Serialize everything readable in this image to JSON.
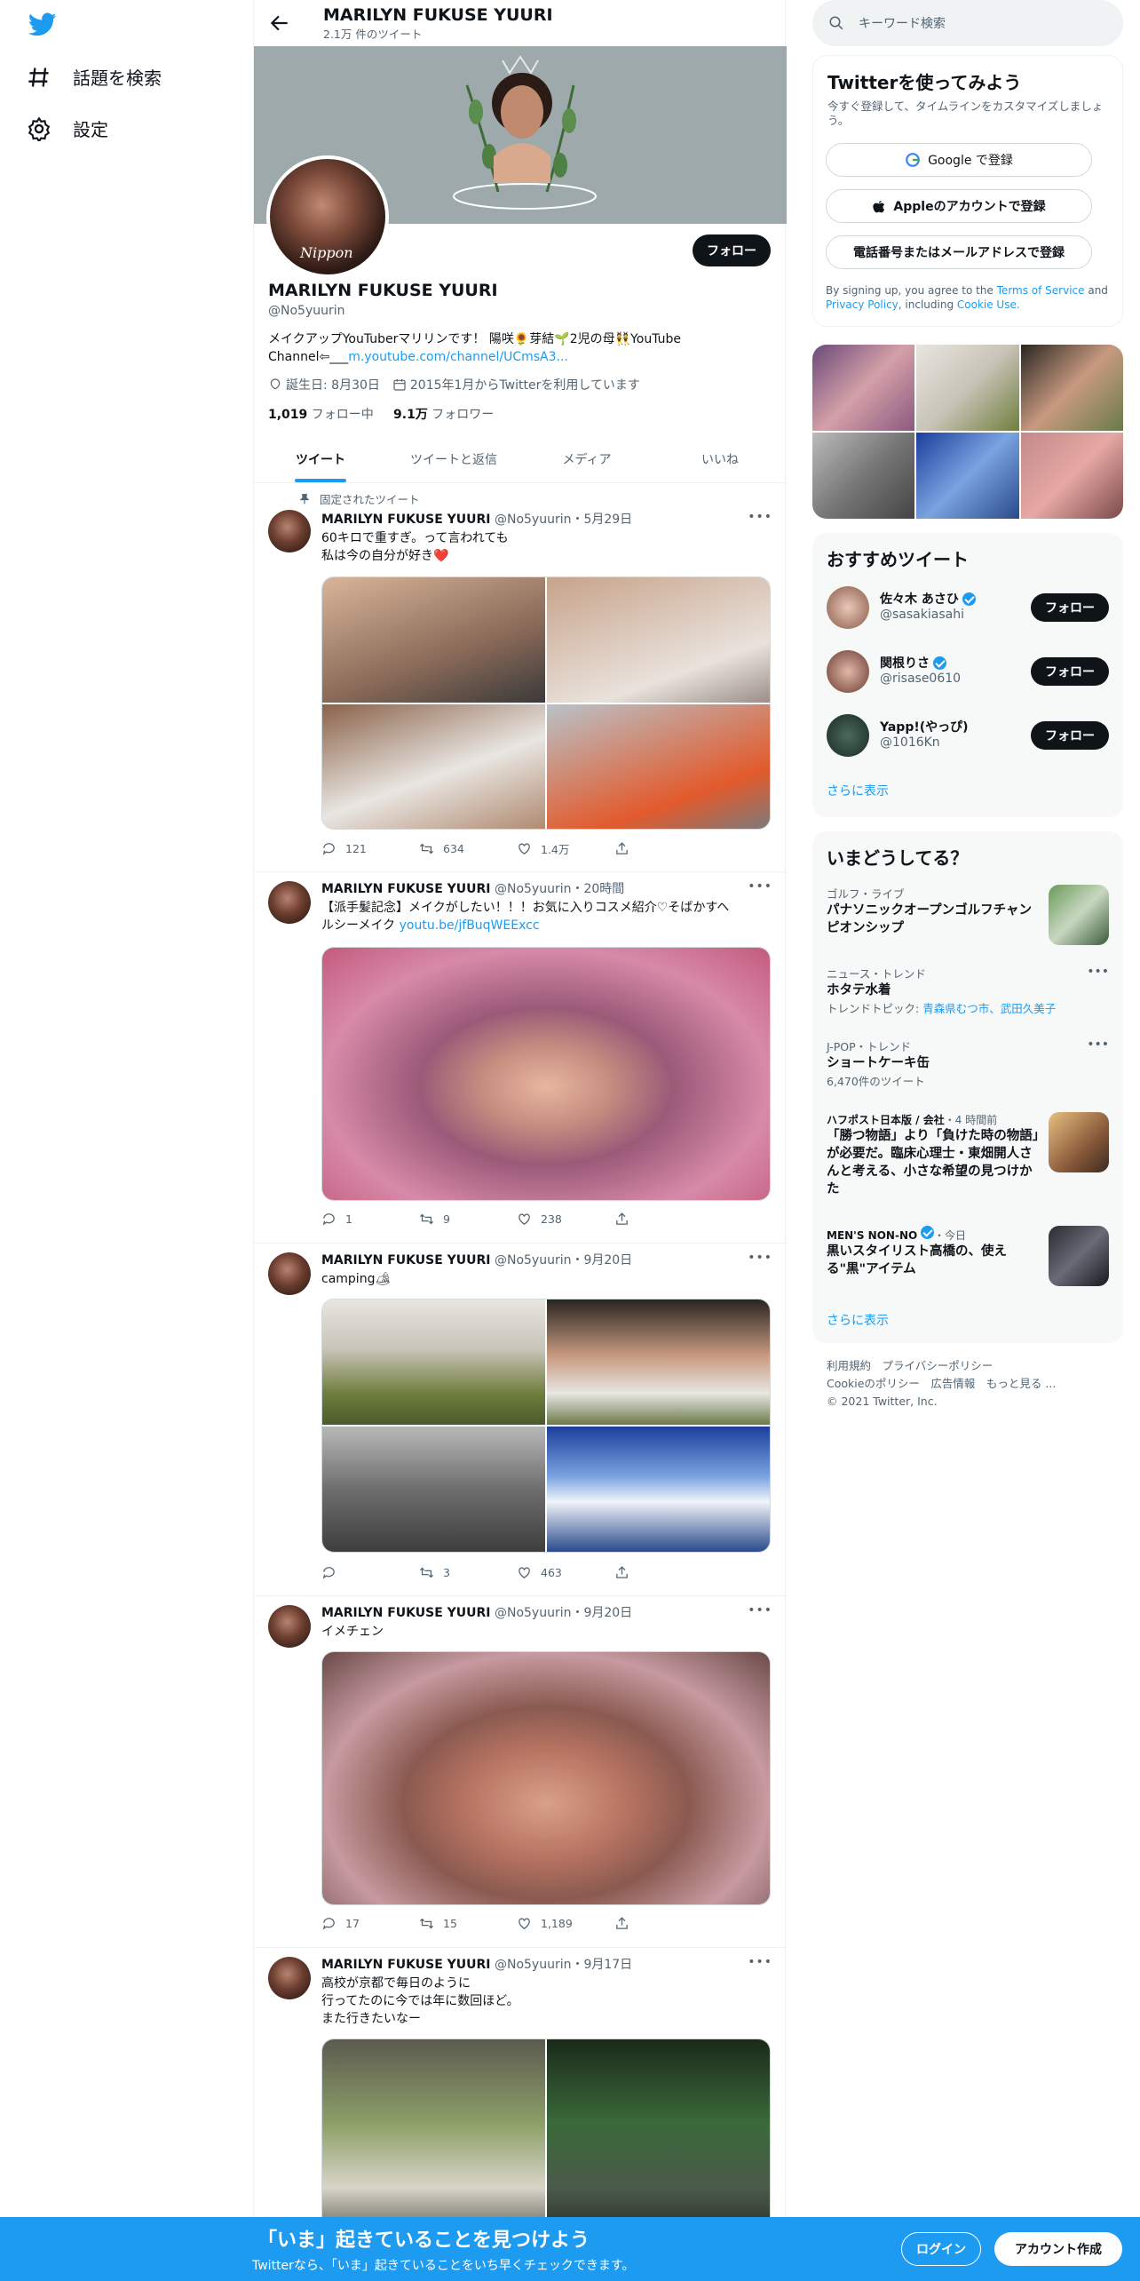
{
  "nav": {
    "explore_label": "話題を検索",
    "settings_label": "設定"
  },
  "header": {
    "name": "MARILYN FUKUSE YUURI",
    "tweet_count": "2.1万 件のツイート"
  },
  "profile": {
    "name": "MARILYN FUKUSE YUURI",
    "handle": "@No5yuurin",
    "follow_label": "フォロー",
    "avatar_text": "Nippon",
    "bio_text": "メイクアップYouTuberマリリンです！ 陽咲🌻芽結🌱2児の母👯YouTube Channel⇦___",
    "bio_link": "m.youtube.com/channel/UCmsA3...",
    "birthday": "誕生日: 8月30日",
    "joined": "2015年1月からTwitterを利用しています",
    "following_count": "1,019",
    "following_label": "フォロー中",
    "followers_count": "9.1万",
    "followers_label": "フォロワー"
  },
  "tabs": [
    "ツイート",
    "ツイートと返信",
    "メディア",
    "いいね"
  ],
  "pinned_label": "固定されたツイート",
  "tweets": [
    {
      "name": "MARILYN FUKUSE YUURI",
      "meta": "@No5yuurin・5月29日",
      "text_line1": "60キロで重すぎ。って言われても",
      "text_line2": "私は今の自分が好き❤️",
      "replies": "121",
      "retweets": "634",
      "likes": "1.4万"
    },
    {
      "name": "MARILYN FUKUSE YUURI",
      "meta": "@No5yuurin・20時間",
      "text_line1": "【派手髪記念】メイクがしたい！！！お気に入りコスメ紹介♡そばかすヘ",
      "text_line2": "ルシーメイク",
      "link": "youtu.be/jfBuqWEExcc",
      "replies": "1",
      "retweets": "9",
      "likes": "238"
    },
    {
      "name": "MARILYN FUKUSE YUURI",
      "meta": "@No5yuurin・9月20日",
      "text_line1": "camping🏕",
      "replies": "",
      "retweets": "3",
      "likes": "463"
    },
    {
      "name": "MARILYN FUKUSE YUURI",
      "meta": "@No5yuurin・9月20日",
      "text_line1": "イメチェン",
      "replies": "17",
      "retweets": "15",
      "likes": "1,189"
    },
    {
      "name": "MARILYN FUKUSE YUURI",
      "meta": "@No5yuurin・9月17日",
      "text_line1": "高校が京都で毎日のように",
      "text_line2": "行ってたのに今では年に数回ほど。",
      "text_line3": "また行きたいなー"
    }
  ],
  "search": {
    "placeholder": "キーワード検索"
  },
  "signup": {
    "title": "Twitterを使ってみよう",
    "subtitle": "今すぐ登録して、タイムラインをカスタマイズしましょう。",
    "google": "Google で登録",
    "apple": "Appleのアカウントで登録",
    "phone": "電話番号またはメールアドレスで登録",
    "terms_prefix": "By signing up, you agree to the ",
    "terms_link": "Terms of Service",
    "terms_and": " and ",
    "privacy_link": "Privacy Policy",
    "terms_including": ", including ",
    "cookie_link": "Cookie Use."
  },
  "recommend": {
    "title": "おすすめツイート",
    "users": [
      {
        "name": "佐々木 あさひ",
        "handle": "@sasakiasahi",
        "follow": "フォロー"
      },
      {
        "name": "関根りさ",
        "handle": "@risase0610",
        "follow": "フォロー"
      },
      {
        "name": "Yapp!(やっぴ)",
        "handle": "@1016Kn",
        "follow": "フォロー"
      }
    ],
    "more": "さらに表示"
  },
  "trends": {
    "title": "いまどうしてる？",
    "items": [
      {
        "category": "ゴルフ・ライブ",
        "title": "パナソニックオープンゴルフチャンピオンシップ"
      },
      {
        "category": "ニュース・トレンド",
        "title": "ホタテ水着",
        "sub_prefix": "トレンドトピック: ",
        "sub_links": "青森県むつ市、武田久美子"
      },
      {
        "category": "J-POP・トレンド",
        "title": "ショートケーキ缶",
        "sub": "6,470件のツイート"
      },
      {
        "source": "ハフポスト日本版 / 会社",
        "time": "・4 時間前",
        "title": "「勝つ物語」より「負けた時の物語」が必要だ。臨床心理士・東畑開人さんと考える、小さな希望の見つけかた"
      },
      {
        "source": "MEN'S NON-NO",
        "time": "・今日",
        "title": "黒いスタイリスト高橋の、使える\"黒\"アイテム"
      }
    ],
    "more": "さらに表示"
  },
  "footer": {
    "line1": "利用規約　プライバシーポリシー",
    "line2": "Cookieのポリシー　広告情報　もっと見る ...",
    "line3": "© 2021 Twitter, Inc."
  },
  "bottom": {
    "title": "「いま」起きていることを見つけよう",
    "subtitle": "Twitterなら、「いま」起きていることをいち早くチェックできます。",
    "login": "ログイン",
    "signup": "アカウント作成"
  },
  "colors": {
    "accent": "#1d9bf0",
    "text": "#0f1419",
    "muted": "#536471"
  }
}
